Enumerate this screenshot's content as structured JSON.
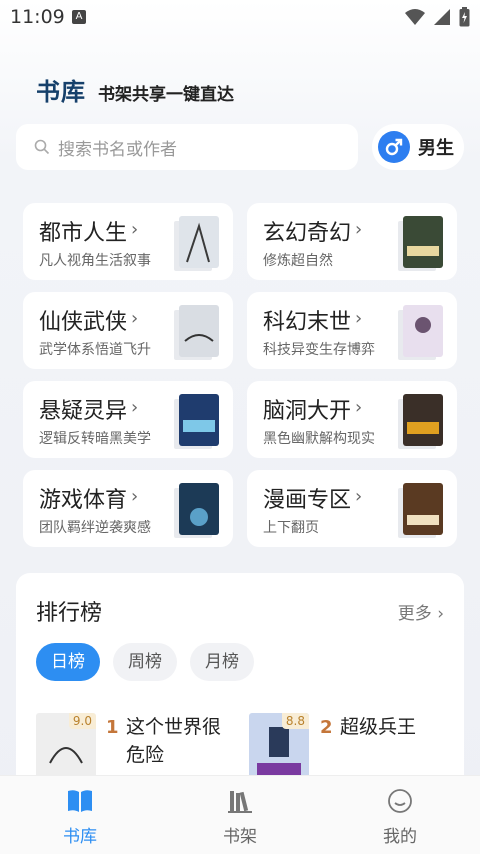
{
  "status": {
    "time": "11:09",
    "notif_letter": "A"
  },
  "header": {
    "title": "书库",
    "subtitle": "书架共享一键直达"
  },
  "search": {
    "placeholder": "搜索书名或作者"
  },
  "gender": {
    "label": "男生"
  },
  "categories": [
    {
      "name": "都市人生",
      "desc": "凡人视角生活叙事",
      "cover_color": "#dfe4ea"
    },
    {
      "name": "玄幻奇幻",
      "desc": "修炼超自然",
      "cover_color": "#3a4a36"
    },
    {
      "name": "仙侠武侠",
      "desc": "武学体系悟道飞升",
      "cover_color": "#d9dde3"
    },
    {
      "name": "科幻末世",
      "desc": "科技异变生存博弈",
      "cover_color": "#e8dfee"
    },
    {
      "name": "悬疑灵异",
      "desc": "逻辑反转暗黑美学",
      "cover_color": "#1f3c6e"
    },
    {
      "name": "脑洞大开",
      "desc": "黑色幽默解构现实",
      "cover_color": "#3a2f28"
    },
    {
      "name": "游戏体育",
      "desc": "团队羁绊逆袭爽感",
      "cover_color": "#1c3a56"
    },
    {
      "name": "漫画专区",
      "desc": "上下翻页",
      "cover_color": "#5a3a22"
    }
  ],
  "ranking": {
    "title": "排行榜",
    "more": "更多",
    "tabs": [
      "日榜",
      "周榜",
      "月榜"
    ],
    "items": [
      {
        "rank": "1",
        "title_line1": "这个世界很",
        "title_line2": "危险",
        "score": "9.0",
        "cover_color": "#eeeeee"
      },
      {
        "rank": "2",
        "title_line1": "超级兵王",
        "title_line2": "",
        "score": "8.8",
        "cover_color": "#c9d6ee"
      }
    ]
  },
  "nav": [
    {
      "label": "书库",
      "active": true
    },
    {
      "label": "书架",
      "active": false
    },
    {
      "label": "我的",
      "active": false
    }
  ],
  "colors": {
    "accent": "#2d8ef2",
    "title": "#16406b",
    "rank": "#c4763a"
  }
}
